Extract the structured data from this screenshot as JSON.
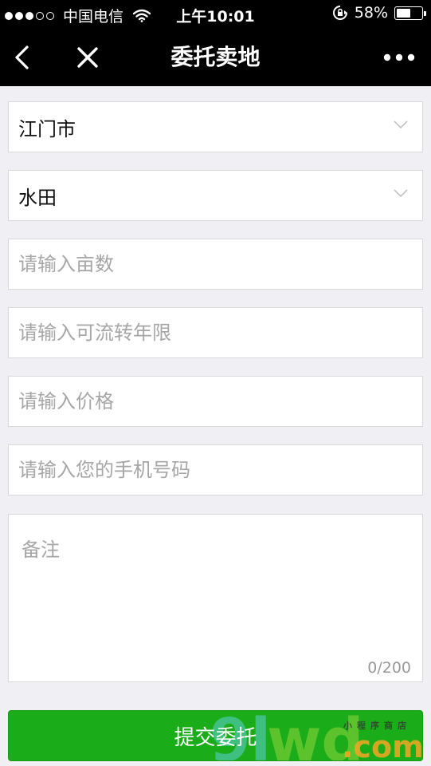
{
  "status_bar": {
    "carrier": "中国电信",
    "time": "上午10:01",
    "battery_percent": "58%",
    "battery_level": 0.58,
    "signal_bars_filled": 3,
    "signal_bars_total": 5
  },
  "nav": {
    "title": "委托卖地",
    "back_icon": "chevron-left-icon",
    "close_icon": "close-icon",
    "more_icon": "more-dots-icon"
  },
  "form": {
    "city_select": {
      "value": "江门市"
    },
    "land_type_select": {
      "value": "水田"
    },
    "area_input": {
      "placeholder": "请输入亩数"
    },
    "term_input": {
      "placeholder": "请输入可流转年限"
    },
    "price_input": {
      "placeholder": "请输入价格"
    },
    "phone_input": {
      "placeholder": "请输入您的手机号码"
    },
    "remark": {
      "placeholder": "备注",
      "counter": "0/200"
    },
    "submit_label": "提交委托"
  },
  "watermark": {
    "text": "9lwd.com",
    "tagline": "小程序商店"
  },
  "colors": {
    "nav_background": "#000000",
    "page_background": "#efeff4",
    "accent_green": "#1aad19",
    "placeholder_gray": "#a6a6a6"
  }
}
